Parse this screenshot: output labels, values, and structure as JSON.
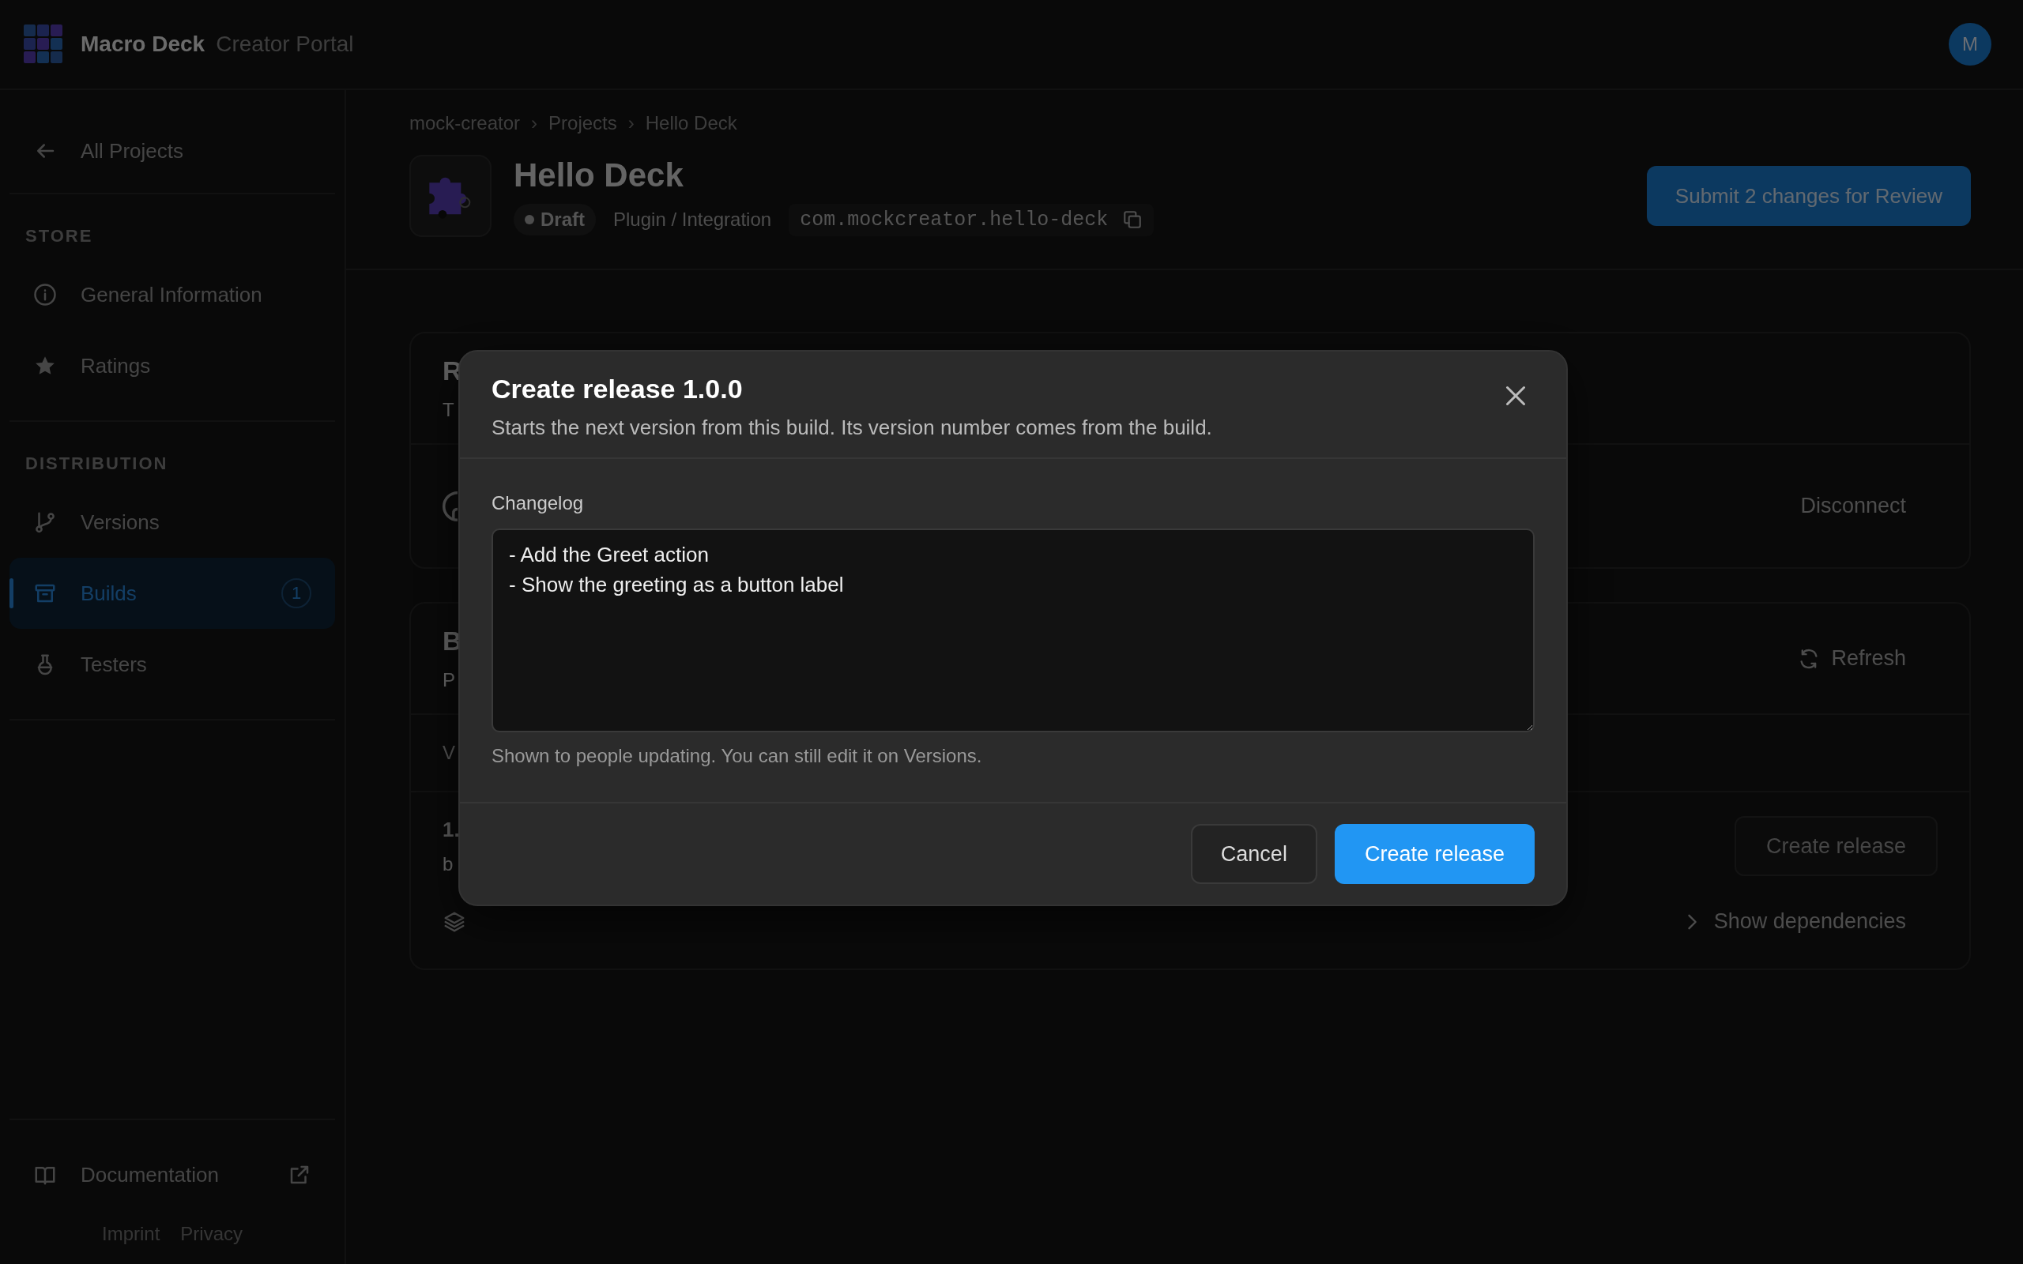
{
  "app_bar": {
    "brand": "Macro Deck",
    "subtitle": "Creator Portal",
    "avatar": "M"
  },
  "sidebar": {
    "back": "All Projects",
    "sections": [
      {
        "heading": "STORE",
        "items": [
          {
            "label": "General Information",
            "selected": false
          },
          {
            "label": "Ratings",
            "selected": false
          }
        ]
      },
      {
        "heading": "DISTRIBUTION",
        "items": [
          {
            "label": "Versions",
            "selected": false
          },
          {
            "label": "Builds",
            "selected": true,
            "badge": "1"
          },
          {
            "label": "Testers",
            "selected": false
          }
        ]
      }
    ],
    "footer": {
      "documentation": "Documentation",
      "links": [
        "Imprint",
        "Privacy"
      ]
    }
  },
  "project": {
    "breadcrumb": [
      "mock-creator",
      "Projects",
      "Hello Deck"
    ],
    "breadcrumb_separator": "›",
    "title": "Hello Deck",
    "status": "Draft",
    "type": "Plugin / Integration",
    "package_id": "com.mockcreator.hello-deck",
    "submit_button": "Submit 2 changes for Review"
  },
  "cards": [
    {
      "kind": "connection",
      "title": "R",
      "subtitle": "T",
      "action": "Disconnect"
    },
    {
      "kind": "builds",
      "title": "B",
      "subtitle": "P",
      "action": "Refresh",
      "column_1": "V",
      "row": {
        "version": "1.",
        "detail": "b",
        "button": "Create release",
        "toggle": "Show dependencies",
        "expanded": false
      }
    }
  ],
  "dialog": {
    "title": "Create release 1.0.0",
    "description": "Starts the next version from this build. Its version number comes from the build.",
    "field_label": "Changelog",
    "value": "- Add the Greet action\n- Show the greeting as a button label",
    "hint": "Shown to people updating. You can still edit it on Versions.",
    "buttons": [
      {
        "label": "Cancel",
        "kind": "secondary"
      },
      {
        "label": "Create release",
        "kind": "primary"
      }
    ]
  }
}
